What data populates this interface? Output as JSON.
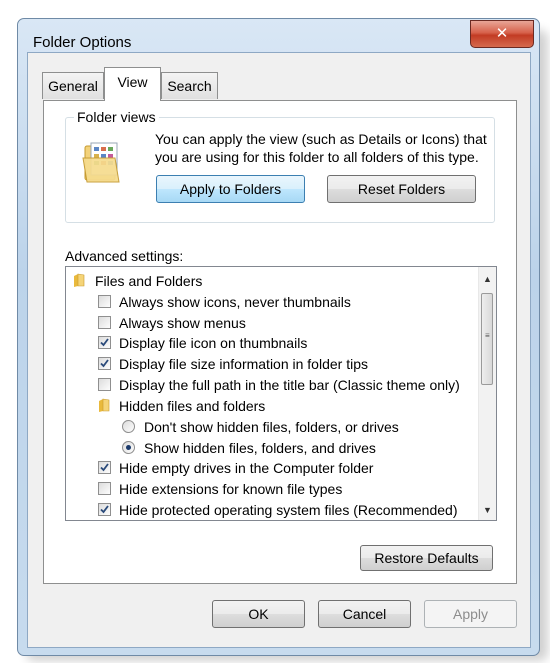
{
  "window": {
    "title": "Folder Options"
  },
  "tabs": [
    {
      "label": "General",
      "active": false
    },
    {
      "label": "View",
      "active": true
    },
    {
      "label": "Search",
      "active": false
    }
  ],
  "folder_views": {
    "legend": "Folder views",
    "description_line1": "You can apply the view (such as Details or Icons) that",
    "description_line2": "you are using for this folder to all folders of this type.",
    "apply_button": "Apply to Folders",
    "reset_button": "Reset Folders"
  },
  "advanced": {
    "label": "Advanced settings:",
    "items": [
      {
        "type": "folder",
        "label": "Files and Folders",
        "level": 0
      },
      {
        "type": "checkbox",
        "label": "Always show icons, never thumbnails",
        "checked": false,
        "level": 1
      },
      {
        "type": "checkbox",
        "label": "Always show menus",
        "checked": false,
        "level": 1
      },
      {
        "type": "checkbox",
        "label": "Display file icon on thumbnails",
        "checked": true,
        "level": 1
      },
      {
        "type": "checkbox",
        "label": "Display file size information in folder tips",
        "checked": true,
        "level": 1
      },
      {
        "type": "checkbox",
        "label": "Display the full path in the title bar (Classic theme only)",
        "checked": false,
        "level": 1
      },
      {
        "type": "folder",
        "label": "Hidden files and folders",
        "level": 1
      },
      {
        "type": "radio",
        "label": "Don't show hidden files, folders, or drives",
        "checked": false,
        "level": 2
      },
      {
        "type": "radio",
        "label": "Show hidden files, folders, and drives",
        "checked": true,
        "level": 2
      },
      {
        "type": "checkbox",
        "label": "Hide empty drives in the Computer folder",
        "checked": true,
        "level": 1
      },
      {
        "type": "checkbox",
        "label": "Hide extensions for known file types",
        "checked": false,
        "level": 1
      },
      {
        "type": "checkbox",
        "label": "Hide protected operating system files (Recommended)",
        "checked": true,
        "level": 1
      }
    ]
  },
  "restore_button": "Restore Defaults",
  "footer": {
    "ok": "OK",
    "cancel": "Cancel",
    "apply": "Apply"
  },
  "colors": {
    "accent": "#3c7fb1",
    "close": "#c23b24",
    "frame": "#bcd3ea"
  }
}
